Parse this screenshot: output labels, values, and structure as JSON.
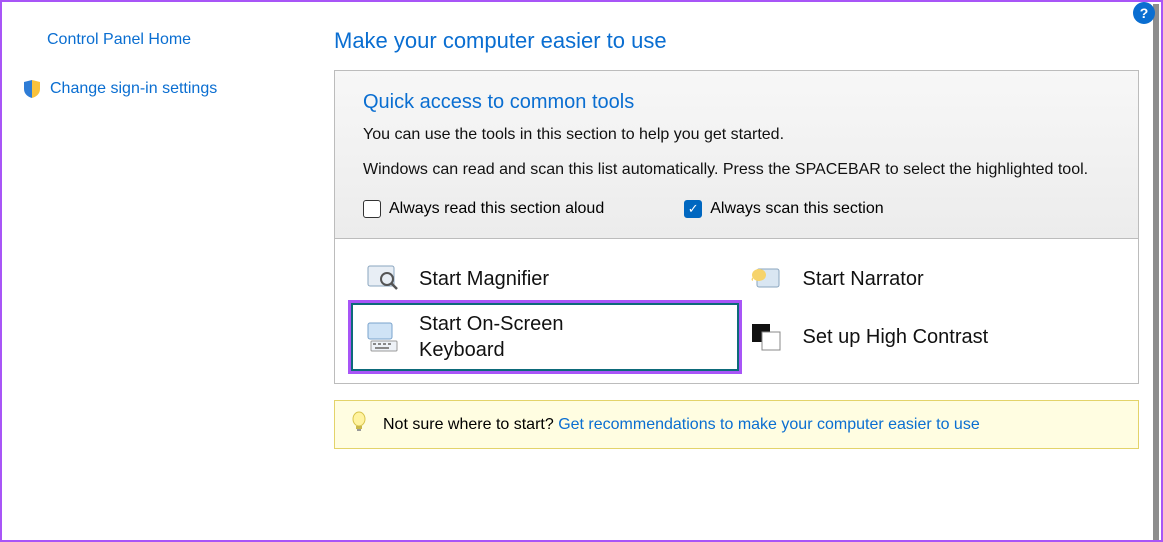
{
  "sidebar": {
    "home": "Control Panel Home",
    "signin": "Change sign-in settings"
  },
  "page": {
    "title": "Make your computer easier to use"
  },
  "quick_access": {
    "title": "Quick access to common tools",
    "desc1": "You can use the tools in this section to help you get started.",
    "desc2": "Windows can read and scan this list automatically.  Press the SPACEBAR to select the highlighted tool.",
    "read_aloud": "Always read this section aloud",
    "scan": "Always scan this section"
  },
  "tools": {
    "magnifier": "Start Magnifier",
    "narrator": "Start Narrator",
    "osk": "Start On-Screen Keyboard",
    "contrast": "Set up High Contrast"
  },
  "recommend": {
    "prompt": "Not sure where to start? ",
    "link": "Get recommendations to make your computer easier to use"
  }
}
